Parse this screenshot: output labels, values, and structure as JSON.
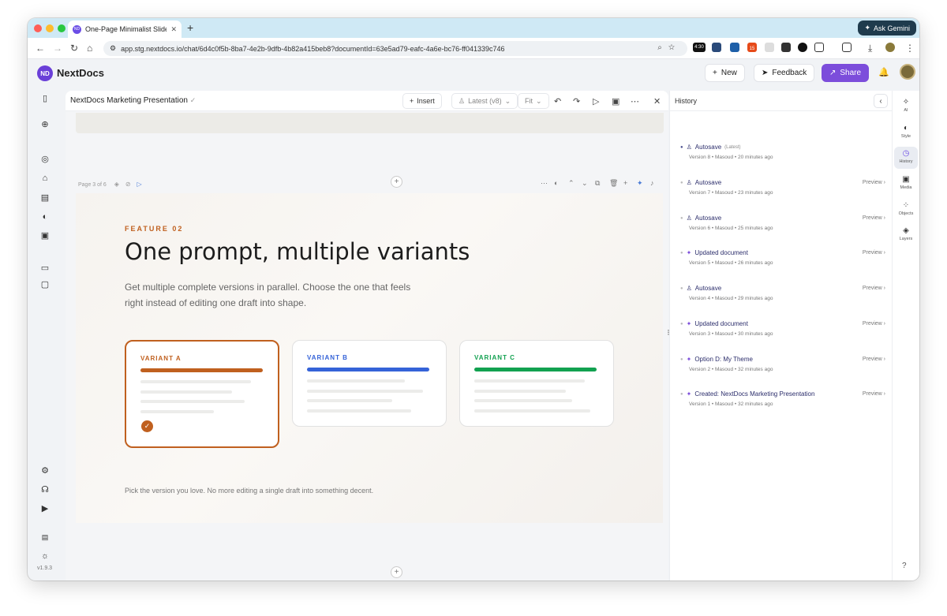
{
  "browser": {
    "tab_title": "One-Page Minimalist Slide fo",
    "tab_icon": "ND",
    "new_tab": "+",
    "gemini_label": "Ask Gemini",
    "url": "app.stg.nextdocs.io/chat/6d4c0f5b-8ba7-4e2b-9dfb-4b82a415beb8?documentId=63e5ad79-eafc-4a6e-bc76-ff041339c746",
    "ext_badge_1": "4:30",
    "ext_badge_2": "15"
  },
  "app": {
    "logo_text": "ND",
    "brand": "NextDocs",
    "new_label": "New",
    "feedback_label": "Feedback",
    "share_label": "Share",
    "version": "v1.9.3"
  },
  "editor": {
    "doc_title": "NextDocs Marketing Presentation",
    "insert_label": "Insert",
    "version_select": "Latest (v8)",
    "zoom": "Fit",
    "page_label": "Page 3 of 6"
  },
  "slide": {
    "eyebrow": "FEATURE 02",
    "heading": "One prompt, multiple variants",
    "subtitle": "Get multiple complete versions in parallel. Choose the one that feels right instead of editing one draft into shape.",
    "variants": [
      {
        "label": "VARIANT A",
        "color": "#c0601f"
      },
      {
        "label": "VARIANT B",
        "color": "#3563d8"
      },
      {
        "label": "VARIANT C",
        "color": "#12a150"
      }
    ],
    "selected_check": "✓",
    "footer": "Pick the version you love. No more editing a single draft into something decent."
  },
  "history": {
    "title": "History",
    "preview_label": "Preview",
    "latest_tag": "(Latest)",
    "items": [
      {
        "title": "Autosave",
        "meta": "Version 8 • Masoud • 20 minutes ago",
        "icon": "user-icon"
      },
      {
        "title": "Autosave",
        "meta": "Version 7 • Masoud • 23 minutes ago",
        "icon": "user-icon"
      },
      {
        "title": "Autosave",
        "meta": "Version 6 • Masoud • 25 minutes ago",
        "icon": "user-icon"
      },
      {
        "title": "Updated document",
        "meta": "Version 5 • Masoud • 26 minutes ago",
        "icon": "sparkle-icon"
      },
      {
        "title": "Autosave",
        "meta": "Version 4 • Masoud • 29 minutes ago",
        "icon": "user-icon"
      },
      {
        "title": "Updated document",
        "meta": "Version 3 • Masoud • 30 minutes ago",
        "icon": "sparkle-icon"
      },
      {
        "title": "Option D: My Theme",
        "meta": "Version 2 • Masoud • 32 minutes ago",
        "icon": "sparkle-icon"
      },
      {
        "title": "Created: NextDocs Marketing Presentation",
        "meta": "Version 1 • Masoud • 32 minutes ago",
        "icon": "sparkle-icon"
      }
    ]
  },
  "right_rail": [
    {
      "label": "AI",
      "icon": "ai-sparkle-icon"
    },
    {
      "label": "Style",
      "icon": "palette-icon"
    },
    {
      "label": "History",
      "icon": "clock-icon"
    },
    {
      "label": "Media",
      "icon": "image-icon"
    },
    {
      "label": "Objects",
      "icon": "objects-icon"
    },
    {
      "label": "Layers",
      "icon": "layers-icon"
    }
  ],
  "help": "?"
}
